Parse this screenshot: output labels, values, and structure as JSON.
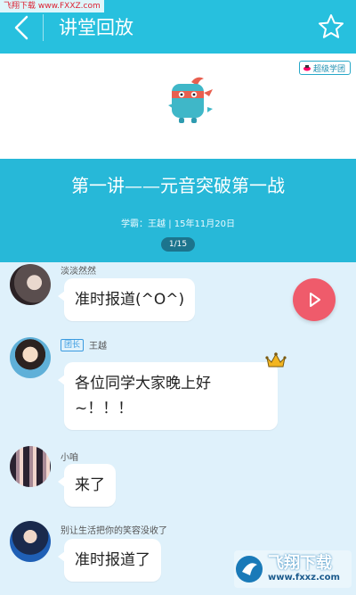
{
  "watermark_top": "飞翔下载 www.FXXZ.com",
  "header": {
    "title": "讲堂回放",
    "back_icon": "chevron-left-icon",
    "star_icon": "star-outline-icon"
  },
  "banner": {
    "badge_label": "超级学团",
    "lesson_title": "第一讲——元音突破第一战",
    "meta": "学霸：王越 | 15年11月20日",
    "page_indicator": "1/15"
  },
  "chat": {
    "messages": [
      {
        "sender": "淡淡然然",
        "role_tag": "",
        "text_lines": [
          "准时报道(^O^)"
        ]
      },
      {
        "sender": "王越",
        "role_tag": "团长",
        "text_lines": [
          "各位同学大家晚上好",
          "~！！！"
        ]
      },
      {
        "sender": "小咱",
        "role_tag": "",
        "text_lines": [
          "来了"
        ]
      },
      {
        "sender": "别让生活把你的笑容没收了",
        "role_tag": "",
        "text_lines": [
          "准时报道了"
        ]
      }
    ]
  },
  "watermark_bottom": {
    "name": "飞翔下载",
    "url": "www.fxxz.com"
  },
  "colors": {
    "header_bg": "#27c0de",
    "banner_bg": "#27b8d8",
    "chat_bg": "#dff1fb",
    "play_button": "#ef5b6b"
  }
}
